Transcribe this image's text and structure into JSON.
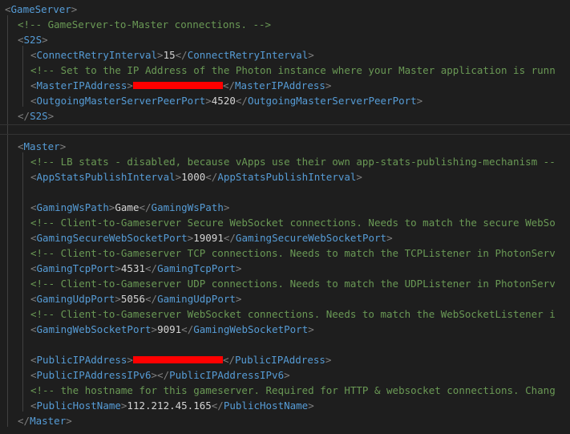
{
  "colors": {
    "background": "#1e1e1e",
    "tag": "#569cd6",
    "bracket": "#808080",
    "text": "#d4d4d4",
    "comment": "#6a9955",
    "redaction": "#ff0000"
  },
  "code": {
    "gameserver_tag": "GameServer",
    "s2s_comment": "<!-- GameServer-to-Master connections. -->",
    "s2s_tag": "S2S",
    "connect_retry_tag": "ConnectRetryInterval",
    "connect_retry_value": "15",
    "master_ip_comment": "<!-- Set to the IP Address of the Photon instance where your Master application is runn",
    "master_ip_tag": "MasterIPAddress",
    "outgoing_port_tag": "OutgoingMasterServerPeerPort",
    "outgoing_port_value": "4520",
    "master_tag": "Master",
    "lb_stats_comment": "<!-- LB stats - disabled, because vApps use their own app-stats-publishing-mechanism --",
    "app_stats_tag": "AppStatsPublishInterval",
    "app_stats_value": "1000",
    "gaming_ws_path_tag": "GamingWsPath",
    "gaming_ws_path_value": "Game",
    "secure_ws_comment": "<!-- Client-to-Gameserver Secure WebSocket connections. Needs to match the secure WebSo",
    "secure_ws_port_tag": "GamingSecureWebSocketPort",
    "secure_ws_port_value": "19091",
    "tcp_comment": "<!-- Client-to-Gameserver TCP connections. Needs to match the TCPListener in PhotonServ",
    "tcp_port_tag": "GamingTcpPort",
    "tcp_port_value": "4531",
    "udp_comment": "<!-- Client-to-Gameserver UDP connections. Needs to match the UDPListener in PhotonServ",
    "udp_port_tag": "GamingUdpPort",
    "udp_port_value": "5056",
    "ws_comment": "<!-- Client-to-Gameserver WebSocket connections. Needs to match the WebSocketListener i",
    "ws_port_tag": "GamingWebSocketPort",
    "ws_port_value": "9091",
    "public_ip_tag": "PublicIPAddress",
    "public_ipv6_tag": "PublicIPAddressIPv6",
    "hostname_comment": "<!-- the hostname for this gameserver. Required for HTTP & websocket connections. Chang",
    "public_host_tag": "PublicHostName",
    "public_host_value": "112.212.45.165"
  }
}
